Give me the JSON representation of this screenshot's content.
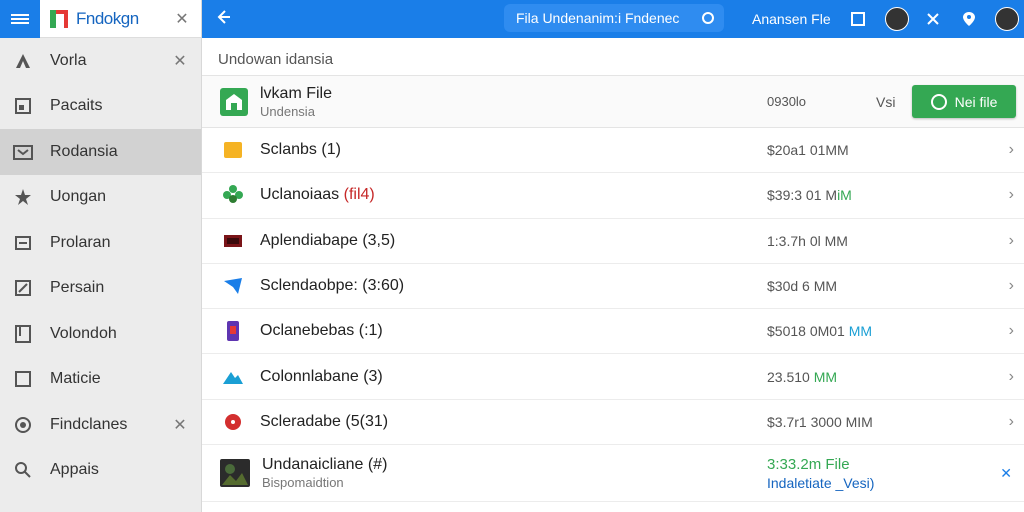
{
  "app": {
    "title": "Fndokgn"
  },
  "sidebar": {
    "items": [
      {
        "label": "Vorla",
        "icon": "triangle-icon",
        "closable": true
      },
      {
        "label": "Pacaits",
        "icon": "file-icon",
        "closable": false
      },
      {
        "label": "Rodansia",
        "icon": "folder-icon",
        "closable": false,
        "active": true
      },
      {
        "label": "Uongan",
        "icon": "star-icon",
        "closable": false
      },
      {
        "label": "Prolaran",
        "icon": "box-icon",
        "closable": false
      },
      {
        "label": "Persain",
        "icon": "edit-icon",
        "closable": false
      },
      {
        "label": "Volondoh",
        "icon": "document-icon",
        "closable": false
      },
      {
        "label": "Maticie",
        "icon": "square-icon",
        "closable": false
      },
      {
        "label": "Findclanes",
        "icon": "circle-icon",
        "closable": true
      },
      {
        "label": "Appais",
        "icon": "search-icon",
        "closable": false
      }
    ]
  },
  "topbar": {
    "search_text": "Fila Undenanim:i Fndenec",
    "label": "Anansen Fle"
  },
  "main": {
    "breadcrumb": "Undowan idansia",
    "header": {
      "title": "lvkam File",
      "subtitle": "Undensia",
      "size": "0930lo",
      "version": "Vsi",
      "button_label": "Nei file"
    },
    "rows": [
      {
        "name": "Sclanbs (1)",
        "name_hl": "",
        "size": "$20a1 01MM",
        "size_accent": "",
        "icon": "folder-yellow-icon"
      },
      {
        "name": "Uclanoiaas ",
        "name_hl": "(fil4)",
        "size": "$39:3 01 M",
        "size_accent": "iM",
        "icon": "plant-icon"
      },
      {
        "name": "Aplendiabape (3,5)",
        "name_hl": "",
        "size": "1:3.7h 0l MM",
        "size_accent": "",
        "icon": "dark-box-icon"
      },
      {
        "name": "Sclendaobpe: (3:60)",
        "name_hl": "",
        "size": "$30d 6 MM",
        "size_accent": "",
        "icon": "mail-icon"
      },
      {
        "name": "Oclanebebas (:1)",
        "name_hl": "",
        "size": "$5018 0M01",
        "size_accent2": "MM",
        "icon": "phone-icon"
      },
      {
        "name": "Colonnlabane (3)",
        "name_hl": "",
        "size": "23.510",
        "size_accent": "MM",
        "icon": "mountain-icon"
      },
      {
        "name": "Scleradabe (5(31)",
        "name_hl": "",
        "size": "$3.7r1 3000 MIM",
        "size_accent": "",
        "icon": "red-circle-icon"
      }
    ],
    "last_row": {
      "name": "Undanaicliane (#)",
      "subtitle": "Bispomaidtion",
      "size": "3:33.2m File",
      "size_sub": "Indaletiate _Vesi)",
      "icon": "image-thumb-icon"
    }
  },
  "colors": {
    "accent": "#1a7ee8",
    "green": "#34a853",
    "sidebar_bg": "#ececec",
    "active_bg": "#d2d2d2"
  }
}
